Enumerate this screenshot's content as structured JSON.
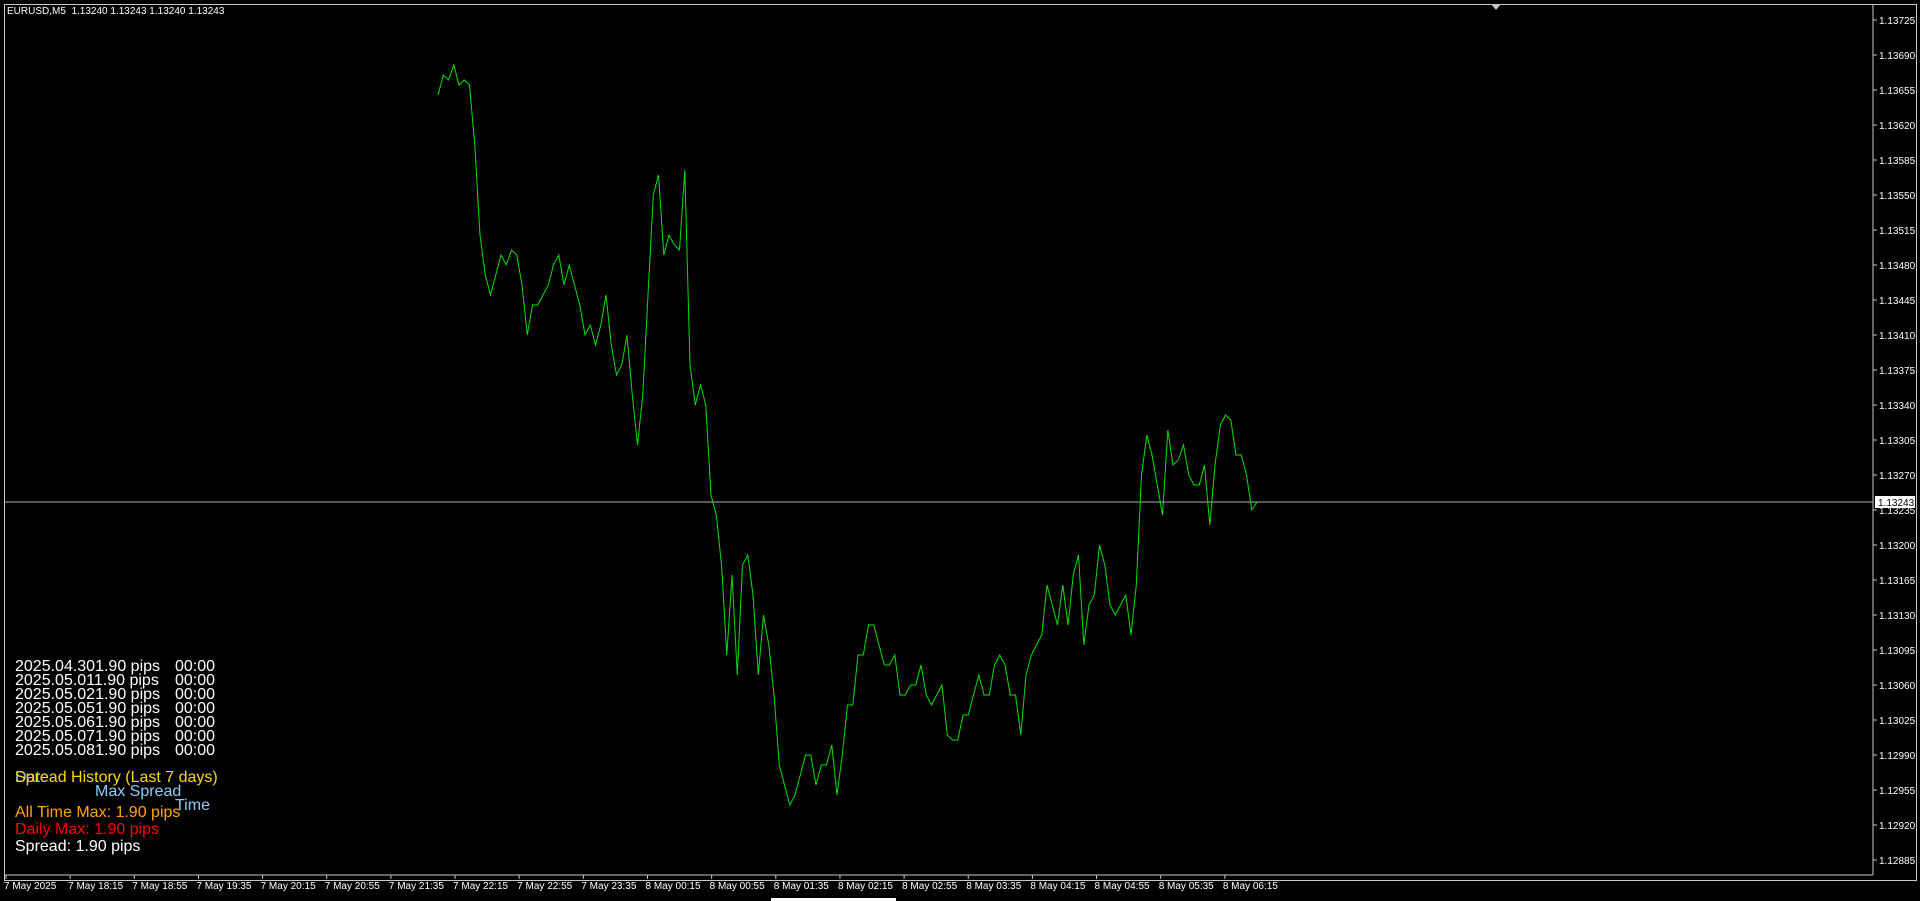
{
  "window": {
    "symbol_info": "EURUSD,M5  1.13240 1.13243 1.13240 1.13243"
  },
  "colors": {
    "background": "#000000",
    "line": "#00e000",
    "axis_text": "#ffffff",
    "frame": "#c8c8c8",
    "bid_line": "#b0b0b0",
    "panel_header_date": "#87cefa",
    "panel_title": "#ffd700",
    "all_time_max": "#ffa500",
    "daily_max": "#ff0000",
    "spread": "#ffffff"
  },
  "panel": {
    "rows": [
      {
        "date": "2025.04.30",
        "spread": "1.90 pips",
        "time": "00:00"
      },
      {
        "date": "2025.05.01",
        "spread": "1.90 pips",
        "time": "00:00"
      },
      {
        "date": "2025.05.02",
        "spread": "1.90 pips",
        "time": "00:00"
      },
      {
        "date": "2025.05.05",
        "spread": "1.90 pips",
        "time": "00:00"
      },
      {
        "date": "2025.05.06",
        "spread": "1.90 pips",
        "time": "00:00"
      },
      {
        "date": "2025.05.07",
        "spread": "1.90 pips",
        "time": "00:00"
      },
      {
        "date": "2025.05.08",
        "spread": "1.90 pips",
        "time": "00:00"
      }
    ],
    "header_date": "Date",
    "header_spread": "Max Spread",
    "header_time": "Time",
    "title": "Spread History (Last 7 days)",
    "all_time_max": "All Time Max: 1.90 pips",
    "daily_max": "Daily Max: 1.90 pips",
    "spread": "Spread: 1.90 pips"
  },
  "chart_data": {
    "type": "line",
    "symbol": "EURUSD",
    "timeframe": "M5",
    "current_price": "1.13243",
    "current_price_value": 1.13243,
    "ylim": [
      1.1287,
      1.1374
    ],
    "y_ticks": [
      "1.13725",
      "1.13690",
      "1.13655",
      "1.13620",
      "1.13585",
      "1.13550",
      "1.13515",
      "1.13480",
      "1.13445",
      "1.13410",
      "1.13375",
      "1.13340",
      "1.13305",
      "1.13270",
      "1.13235",
      "1.13200",
      "1.13165",
      "1.13130",
      "1.13095",
      "1.13060",
      "1.13025",
      "1.12990",
      "1.12955",
      "1.12920",
      "1.12885"
    ],
    "x_ticks": [
      "7 May 2025",
      "7 May 18:15",
      "7 May 18:55",
      "7 May 19:35",
      "7 May 20:15",
      "7 May 20:55",
      "7 May 21:35",
      "7 May 22:15",
      "7 May 22:55",
      "7 May 23:35",
      "8 May 00:15",
      "8 May 00:55",
      "8 May 01:35",
      "8 May 02:15",
      "8 May 02:55",
      "8 May 03:35",
      "8 May 04:15",
      "8 May 04:55",
      "8 May 05:35",
      "8 May 06:15"
    ],
    "bar_count_to_last": 248,
    "bars_per_tick": 8,
    "close_values": [
      1.1365,
      1.1367,
      1.13665,
      1.1368,
      1.1366,
      1.13665,
      1.1366,
      1.136,
      1.1351,
      1.1347,
      1.1345,
      1.1347,
      1.1349,
      1.1348,
      1.13495,
      1.1349,
      1.1346,
      1.1341,
      1.1344,
      1.1344,
      1.1345,
      1.1346,
      1.1348,
      1.1349,
      1.1346,
      1.1348,
      1.1346,
      1.1344,
      1.1341,
      1.1342,
      1.134,
      1.1342,
      1.1345,
      1.134,
      1.1337,
      1.1338,
      1.1341,
      1.1335,
      1.133,
      1.1335,
      1.1345,
      1.1355,
      1.1357,
      1.1349,
      1.1351,
      1.135,
      1.13495,
      1.13575,
      1.1338,
      1.1334,
      1.1336,
      1.1334,
      1.1325,
      1.1323,
      1.1318,
      1.1309,
      1.1317,
      1.1307,
      1.1318,
      1.1319,
      1.1315,
      1.1307,
      1.1313,
      1.131,
      1.1305,
      1.1298,
      1.1296,
      1.1294,
      1.1295,
      1.1297,
      1.1299,
      1.1299,
      1.1296,
      1.1298,
      1.1298,
      1.13,
      1.1295,
      1.1299,
      1.1304,
      1.1304,
      1.1309,
      1.1309,
      1.1312,
      1.1312,
      1.131,
      1.1308,
      1.1308,
      1.1309,
      1.1305,
      1.1305,
      1.1306,
      1.1306,
      1.1308,
      1.1305,
      1.1304,
      1.1305,
      1.1306,
      1.1301,
      1.13005,
      1.13005,
      1.1303,
      1.1303,
      1.1305,
      1.1307,
      1.1305,
      1.1305,
      1.1308,
      1.1309,
      1.1308,
      1.1305,
      1.1305,
      1.1301,
      1.1307,
      1.1309,
      1.131,
      1.1311,
      1.1316,
      1.1314,
      1.1312,
      1.1316,
      1.1312,
      1.1317,
      1.1319,
      1.131,
      1.1314,
      1.1315,
      1.132,
      1.1318,
      1.1314,
      1.1313,
      1.1314,
      1.1315,
      1.1311,
      1.1316,
      1.1327,
      1.1331,
      1.1329,
      1.1326,
      1.1323,
      1.13315,
      1.1328,
      1.13285,
      1.133,
      1.1327,
      1.1326,
      1.1326,
      1.1328,
      1.1322,
      1.1328,
      1.1332,
      1.1333,
      1.13325,
      1.1329,
      1.1329,
      1.1327,
      1.13235,
      1.13243
    ]
  }
}
